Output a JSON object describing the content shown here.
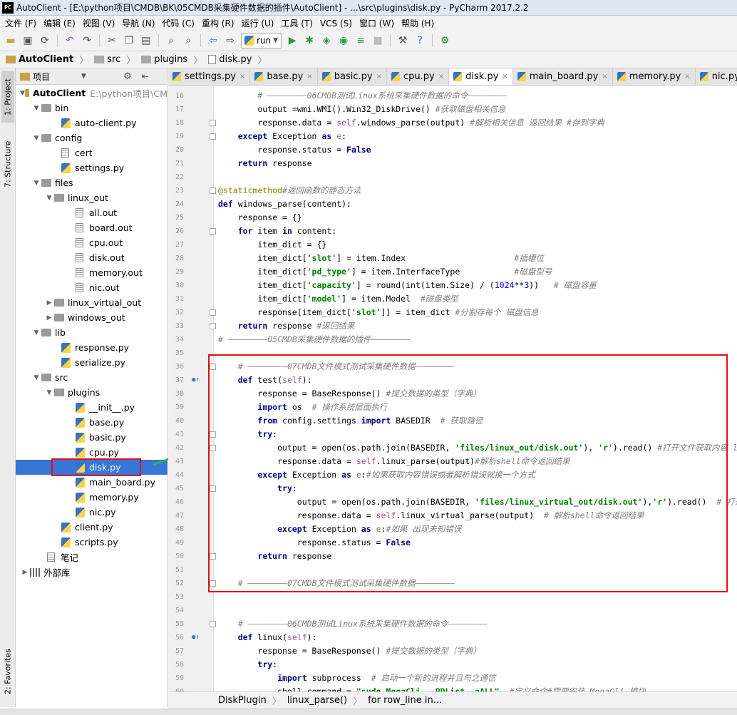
{
  "window": {
    "app_icon": "PC",
    "title": "AutoClient - [E:\\python项目\\CMDB\\BK\\05CMDB采集硬件数据的插件\\AutoClient] - ...\\src\\plugins\\disk.py - PyCharm 2017.2.2"
  },
  "menu": [
    "文件 (F)",
    "编辑 (E)",
    "视图 (V)",
    "导航 (N)",
    "代码 (C)",
    "重构 (R)",
    "运行 (U)",
    "工具 (T)",
    "VCS (S)",
    "窗口 (W)",
    "帮助 (H)"
  ],
  "toolbar": {
    "run_config": "run"
  },
  "breadcrumb": [
    "AutoClient",
    "src",
    "plugins",
    "disk.py"
  ],
  "left_strip": {
    "project": "1: Project",
    "structure": "7: Structure",
    "favorites": "2: Favorites"
  },
  "project_panel": {
    "title": "项目",
    "tree": [
      {
        "label": "AutoClient",
        "extra": "E:\\python项目\\CM",
        "type": "root"
      },
      {
        "label": "bin",
        "type": "folder"
      },
      {
        "label": "auto-client.py",
        "type": "py"
      },
      {
        "label": "config",
        "type": "folder"
      },
      {
        "label": "cert",
        "type": "file"
      },
      {
        "label": "settings.py",
        "type": "py"
      },
      {
        "label": "files",
        "type": "folder"
      },
      {
        "label": "linux_out",
        "type": "folder"
      },
      {
        "label": "all.out",
        "type": "file"
      },
      {
        "label": "board.out",
        "type": "file"
      },
      {
        "label": "cpu.out",
        "type": "file"
      },
      {
        "label": "disk.out",
        "type": "file"
      },
      {
        "label": "memory.out",
        "type": "file"
      },
      {
        "label": "nic.out",
        "type": "file"
      },
      {
        "label": "linux_virtual_out",
        "type": "folder"
      },
      {
        "label": "windows_out",
        "type": "folder"
      },
      {
        "label": "lib",
        "type": "folder"
      },
      {
        "label": "response.py",
        "type": "py"
      },
      {
        "label": "serialize.py",
        "type": "py"
      },
      {
        "label": "src",
        "type": "folder"
      },
      {
        "label": "plugins",
        "type": "folder"
      },
      {
        "label": "__init__.py",
        "type": "py"
      },
      {
        "label": "base.py",
        "type": "py"
      },
      {
        "label": "basic.py",
        "type": "py"
      },
      {
        "label": "cpu.py",
        "type": "py"
      },
      {
        "label": "disk.py",
        "type": "py",
        "selected": true
      },
      {
        "label": "main_board.py",
        "type": "py"
      },
      {
        "label": "memory.py",
        "type": "py"
      },
      {
        "label": "nic.py",
        "type": "py"
      },
      {
        "label": "client.py",
        "type": "py"
      },
      {
        "label": "scripts.py",
        "type": "py"
      },
      {
        "label": "笔记",
        "type": "file"
      },
      {
        "label": "外部库",
        "type": "lib"
      }
    ]
  },
  "tabs": [
    {
      "label": "settings.py"
    },
    {
      "label": "base.py"
    },
    {
      "label": "basic.py"
    },
    {
      "label": "cpu.py"
    },
    {
      "label": "disk.py",
      "active": true
    },
    {
      "label": "main_board.py"
    },
    {
      "label": "memory.py"
    },
    {
      "label": "nic.py"
    }
  ],
  "code_lines": [
    {
      "n": "16",
      "html": "        <span class='c'># ————————06CMDB测试Linux系统采集硬件数据的命令————————</span>"
    },
    {
      "n": "17",
      "html": "        output =wmi.WMI().Win32_DiskDrive() <span class='c'>#获取磁盘相关信息</span>"
    },
    {
      "n": "18",
      "html": "        response.data = <span class='sf'>self</span>.windows_parse(output) <span class='c'>#解析相关信息 返回结果 #存到字典</span>"
    },
    {
      "n": "19",
      "html": "    <span class='k'>except</span> Exception <span class='k'>as</span> <span class='ci'>e</span>:"
    },
    {
      "n": "20",
      "html": "        response.status = <span class='k'>False</span>"
    },
    {
      "n": "21",
      "html": "    <span class='k'>return</span> response"
    },
    {
      "n": "22",
      "html": ""
    },
    {
      "n": "23",
      "html": "<span class='dec'>@staticmethod</span><span class='c'>#返回函数的静态方法</span>"
    },
    {
      "n": "24",
      "html": "<span class='k'>def</span> windows_parse(content):"
    },
    {
      "n": "25",
      "html": "    response = {}"
    },
    {
      "n": "26",
      "html": "    <span class='k'>for</span> item <span class='k'>in</span> content:"
    },
    {
      "n": "27",
      "html": "        item_dict = {}"
    },
    {
      "n": "28",
      "html": "        item_dict[<span class='s'>'slot'</span>] = item.Index                      <span class='c'>#插槽位</span>"
    },
    {
      "n": "29",
      "html": "        item_dict[<span class='s'>'pd_type'</span>] = item.InterfaceType           <span class='c'>#磁盘型号</span>"
    },
    {
      "n": "30",
      "html": "        item_dict[<span class='s'>'capacity'</span>] = round(int(item.Size) / (<span class='n'>1024</span>**<span class='n'>3</span>))   <span class='c'># 磁盘容量</span>"
    },
    {
      "n": "31",
      "html": "        item_dict[<span class='s'>'model'</span>] = item.Model  <span class='c'>#磁盘类型</span>"
    },
    {
      "n": "32",
      "html": "        response[item_dict[<span class='s'>'slot'</span>]] = item_dict <span class='c'>#分割存每个 磁盘信息</span>"
    },
    {
      "n": "33",
      "html": "    <span class='k'>return</span> response <span class='c'>#返回结果</span>"
    },
    {
      "n": "34",
      "html": "<span class='c'># ————————05CMDB采集硬件数据的插件————————</span>"
    },
    {
      "n": "35",
      "html": ""
    },
    {
      "n": "36",
      "html": "    <span class='c'># ————————07CMDB文件模式测试采集硬件数据————————</span>"
    },
    {
      "n": "37",
      "html": "    <span class='k'>def</span> test(<span class='sf'>self</span>):"
    },
    {
      "n": "38",
      "html": "        response = BaseResponse() <span class='c'>#提交数据的类型（字典）</span>"
    },
    {
      "n": "39",
      "html": "        <span class='k'>import</span> os  <span class='c'># 操作系统层面执行</span>"
    },
    {
      "n": "40",
      "html": "        <span class='k'>from</span> config.settings <span class='k'>import</span> BASEDIR  <span class='c'># 获取路径</span>"
    },
    {
      "n": "41",
      "html": "        <span class='k'>try</span>:"
    },
    {
      "n": "42",
      "html": "            output = open(os.path.join(BASEDIR, <span class='s'>'files/linux_out/disk.out'</span>), <span class='s'>'r'</span>).read() <span class='c'>#打开文件获取内容 linux_virt</span>"
    },
    {
      "n": "43",
      "html": "            response.data = <span class='sf'>self</span>.linux_parse(output)<span class='c'>#解析shell命令返回结果</span>"
    },
    {
      "n": "44",
      "html": "        <span class='k'>except</span> Exception <span class='k'>as</span> <span class='ci'>e</span>:<span class='c'>#如果获取内容错误或者解析错误就换一个方式</span>"
    },
    {
      "n": "45",
      "html": "            <span class='k'>try</span>:"
    },
    {
      "n": "46",
      "html": "                output = open(os.path.join(BASEDIR, <span class='s'>'files/linux_virtual_out/disk.out'</span>),<span class='s'>'r'</span>).read()  <span class='c'># 打开文件获取</span>"
    },
    {
      "n": "47",
      "html": "                response.data = <span class='sf'>self</span>.linux_virtual_parse(output)  <span class='c'># 解析shell命令返回结果</span>"
    },
    {
      "n": "48",
      "html": "            <span class='k'>except</span> Exception <span class='k'>as</span> <span class='ci'>e</span>:<span class='c'>#如果 出现未知错误</span>"
    },
    {
      "n": "49",
      "html": "                response.status = <span class='k'>False</span>"
    },
    {
      "n": "50",
      "html": "        <span class='k'>return</span> response"
    },
    {
      "n": "51",
      "html": ""
    },
    {
      "n": "52",
      "html": "    <span class='c'># ————————07CMDB文件模式测试采集硬件数据————————</span>"
    },
    {
      "n": "53",
      "html": ""
    },
    {
      "n": "54",
      "html": ""
    },
    {
      "n": "55",
      "html": "    <span class='c'># ————————06CMDB测试Linux系统采集硬件数据的命令————————</span>"
    },
    {
      "n": "56",
      "html": "    <span class='k'>def</span> linux(<span class='sf'>self</span>):"
    },
    {
      "n": "57",
      "html": "        response = BaseResponse() <span class='c'>#提交数据的类型（字典）</span>"
    },
    {
      "n": "58",
      "html": "        <span class='k'>try</span>:"
    },
    {
      "n": "59",
      "html": "            <span class='k'>import</span> subprocess  <span class='c'># 启动一个新的进程并且与之通信</span>"
    },
    {
      "n": "60",
      "html": "            shell_command = <span class='s'>\"sudo MegaCli  -PDList -aALL\"</span>  <span class='c'>#定义命令#需要安装 MegaCli 模块</span>"
    }
  ],
  "bottom_crumbs": [
    "DiskPlugin",
    "linux_parse()",
    "for row_line in..."
  ]
}
